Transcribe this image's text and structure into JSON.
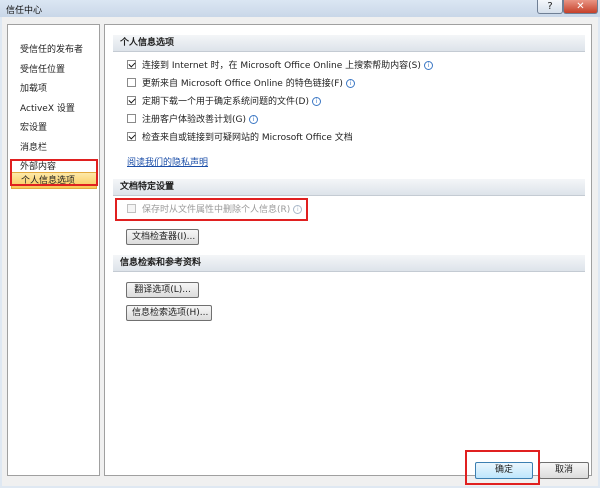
{
  "window": {
    "title": "信任中心",
    "help_glyph": "?",
    "close_glyph": "✕"
  },
  "sidebar": {
    "items": [
      {
        "label": "受信任的发布者"
      },
      {
        "label": "受信任位置"
      },
      {
        "label": "加载项"
      },
      {
        "label": "ActiveX 设置"
      },
      {
        "label": "宏设置"
      },
      {
        "label": "消息栏"
      },
      {
        "label": "外部内容"
      },
      {
        "label": "个人信息选项",
        "selected": true
      }
    ]
  },
  "sections": {
    "personal": {
      "header": "个人信息选项",
      "options": [
        {
          "label": "连接到 Internet 时，在 Microsoft Office Online 上搜索帮助内容(S)",
          "checked": true,
          "info": true
        },
        {
          "label": "更新来自 Microsoft Office Online 的特色链接(F)",
          "checked": false,
          "info": true
        },
        {
          "label": "定期下载一个用于确定系统问题的文件(D)",
          "checked": true,
          "info": true
        },
        {
          "label": "注册客户体验改善计划(G)",
          "checked": false,
          "info": true
        },
        {
          "label": "检查来自或链接到可疑网站的 Microsoft Office 文档",
          "checked": true,
          "info": false
        }
      ],
      "privacy_link": "阅读我们的隐私声明"
    },
    "document": {
      "header": "文档特定设置",
      "option": {
        "label": "保存时从文件属性中删除个人信息(R)",
        "checked": false,
        "disabled": true,
        "info": true
      },
      "inspector_button": "文档检查器(I)..."
    },
    "research": {
      "header": "信息检索和参考资料",
      "translate_button": "翻译选项(L)...",
      "research_button": "信息检索选项(H)..."
    }
  },
  "footer": {
    "ok_label": "确定",
    "cancel_label": "取消"
  },
  "colors": {
    "highlight": "#e02020",
    "link": "#1b4ea8",
    "selected_item": "#f9c858"
  },
  "info_glyph": "i"
}
